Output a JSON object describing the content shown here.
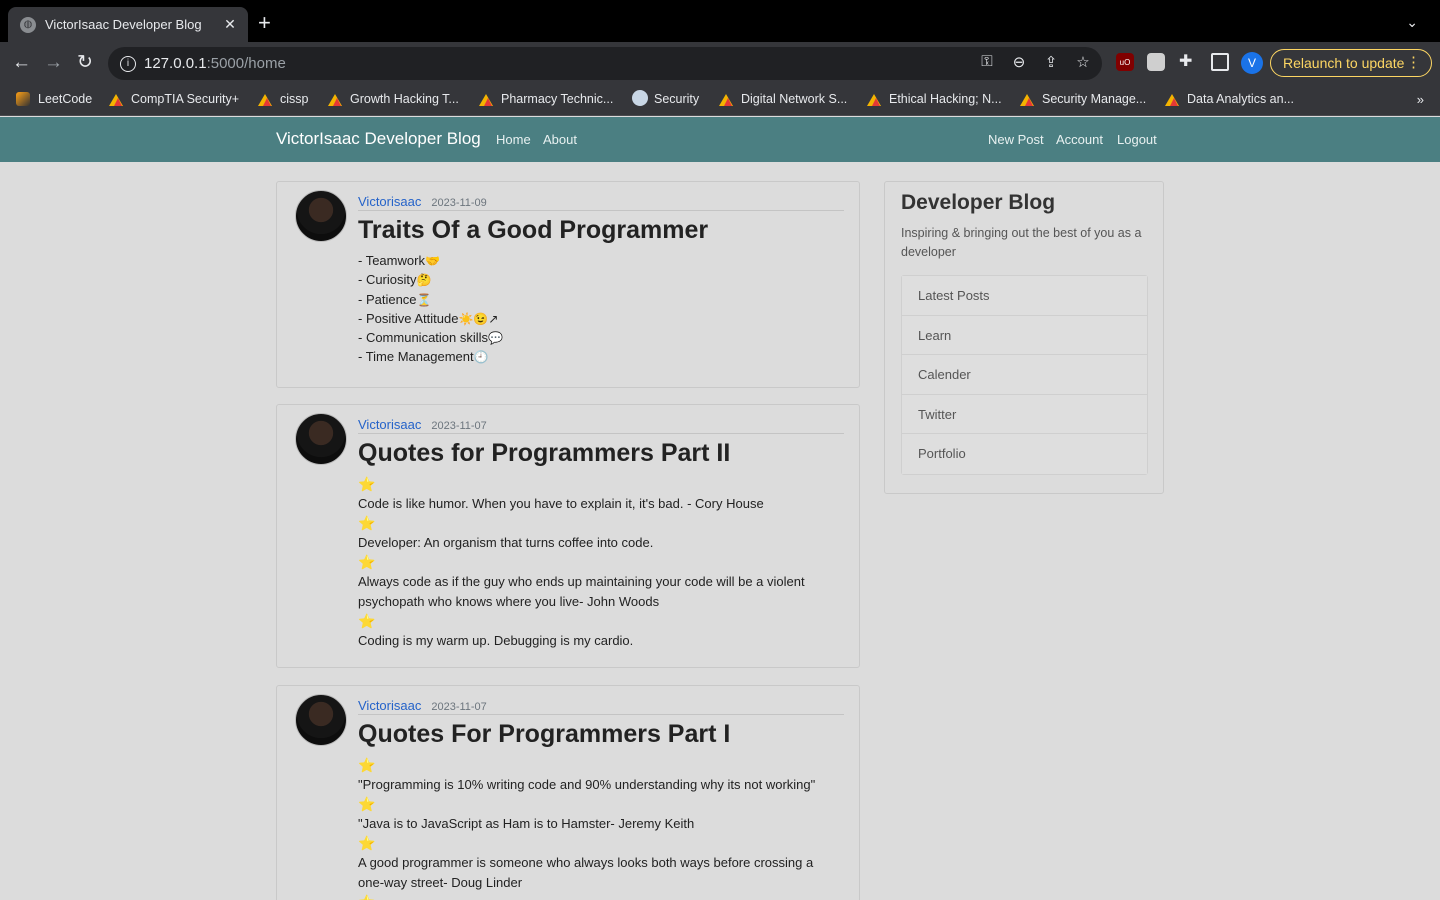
{
  "browser": {
    "tab_title": "VictorIsaac Developer Blog",
    "close_glyph": "✕",
    "newtab_glyph": "+",
    "tabmenu_glyph": "⌄",
    "url_host": "127.0.0.1",
    "url_path": ":5000/home",
    "relaunch_label": "Relaunch to update",
    "profile_initial": "V",
    "ublock_label": "uO",
    "bookmarks": [
      {
        "label": "LeetCode",
        "icon": "leetcode-icon"
      },
      {
        "label": "CompTIA Security+",
        "icon": "google-drive-icon"
      },
      {
        "label": "cissp",
        "icon": "google-drive-icon"
      },
      {
        "label": "Growth Hacking T...",
        "icon": "google-drive-icon"
      },
      {
        "label": "Pharmacy Technic...",
        "icon": "google-drive-icon"
      },
      {
        "label": "Security",
        "icon": "globe-icon"
      },
      {
        "label": "Digital Network S...",
        "icon": "google-drive-icon"
      },
      {
        "label": "Ethical Hacking; N...",
        "icon": "google-drive-icon"
      },
      {
        "label": "Security Manage...",
        "icon": "google-drive-icon"
      },
      {
        "label": "Data Analytics an...",
        "icon": "google-drive-icon"
      }
    ],
    "bookmarks_more": "»"
  },
  "nav": {
    "brand": "VictorIsaac Developer Blog",
    "home": "Home",
    "about": "About",
    "new_post": "New Post",
    "account": "Account",
    "logout": "Logout"
  },
  "posts": [
    {
      "author": "Victorisaac",
      "date": "2023-11-09",
      "title": "Traits Of a Good Programmer",
      "lines": [
        {
          "text": "- Teamwork",
          "emoji": "🤝"
        },
        {
          "text": "- Curiosity",
          "emoji": "🤔"
        },
        {
          "text": "- Patience",
          "emoji": "⏳"
        },
        {
          "text": "- Positive Attitude",
          "emoji": "☀️😉↗"
        },
        {
          "text": "- Communication skills",
          "emoji": "💬"
        },
        {
          "text": "- Time Management",
          "emoji": "🕘"
        }
      ]
    },
    {
      "author": "Victorisaac",
      "date": "2023-11-07",
      "title": "Quotes for Programmers Part II",
      "star": "⭐",
      "quotes": [
        "Code is like humor. When you have to explain it, it's bad. - Cory House",
        "Developer: An organism that turns coffee into code.",
        "Always code as if the guy who ends up maintaining your code will be a violent psychopath who knows where you live- John Woods",
        "Coding is my warm up. Debugging is my cardio."
      ]
    },
    {
      "author": "Victorisaac",
      "date": "2023-11-07",
      "title": "Quotes For Programmers Part I",
      "star": "⭐",
      "quotes": [
        "\"Programming is 10% writing code and 90% understanding why its not working\"",
        "\"Java is to JavaScript as Ham is to Hamster- Jeremy Keith",
        "A good programmer is someone who always looks both ways before crossing a one-way street- Doug Linder"
      ]
    }
  ],
  "sidebar": {
    "title": "Developer Blog",
    "description": "Inspiring & bringing out the best of you as a developer",
    "items": [
      "Latest Posts",
      "Learn",
      "Calender",
      "Twitter",
      "Portfolio"
    ]
  }
}
